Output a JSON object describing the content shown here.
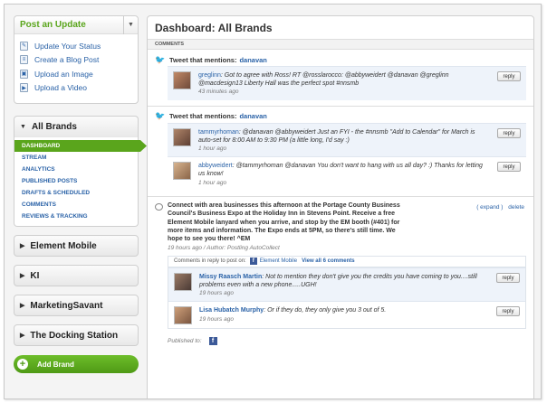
{
  "sidebar": {
    "post_update": {
      "title": "Post an Update",
      "items": [
        {
          "label": "Update Your Status",
          "icon": "status-icon"
        },
        {
          "label": "Create a Blog Post",
          "icon": "blog-icon"
        },
        {
          "label": "Upload an Image",
          "icon": "image-icon"
        },
        {
          "label": "Upload a Video",
          "icon": "video-icon"
        }
      ]
    },
    "all_brands": {
      "label": "All Brands",
      "submenu": [
        "DASHBOARD",
        "STREAM",
        "ANALYTICS",
        "PUBLISHED POSTS",
        "DRAFTS & SCHEDULED",
        "COMMENTS",
        "REVIEWS & TRACKING"
      ],
      "active": "DASHBOARD"
    },
    "brands": [
      "Element Mobile",
      "KI",
      "MarketingSavant",
      "The Docking Station"
    ],
    "add_brand": "Add Brand"
  },
  "main": {
    "title": "Dashboard: All Brands",
    "section_label": "COMMENTS",
    "tweet1": {
      "head": "Tweet that mentions:",
      "mention": "danavan",
      "items": [
        {
          "user": "greglinn",
          "text": ": Got to agree with Ross! RT @rosslarocco: @abbyweidert @danavan @greglinn @macdesign13 Liberty Hall was the perfect spot #nnsmb",
          "time": "43 minutes ago"
        }
      ]
    },
    "tweet2": {
      "head": "Tweet that mentions:",
      "mention": "danavan",
      "items": [
        {
          "user": "tammyrhoman",
          "text": ": @danavan @abbyweidert Just an FYI - the #nnsmb \"Add to Calendar\" for March is auto-set for 8:00 AM to 9:30 PM (a little long, I'd say :)",
          "time": "1 hour ago"
        },
        {
          "user": "abbyweidert",
          "text": ": @tammyrhoman @danavan You don't want to hang with us all day? :) Thanks for letting us know!",
          "time": "1 hour ago"
        }
      ]
    },
    "reply_label": "reply",
    "fb_post": {
      "text": "Connect with area businesses this afternoon at the Portage County Business Council's Business Expo at the Holiday Inn in Stevens Point. Receive a free Element Mobile lanyard when you arrive, and stop by the EM booth (#401) for more items and information. The Expo ends at 5PM, so there's still time. We hope to see you there! ^EM",
      "meta": "19 hours ago / Author: Postling AutoCollect",
      "expand": "( expand )",
      "delete": "delete",
      "comments_head": "Comments in reply to post on:",
      "comments_page": "Element Mobile",
      "view_all": "View all 6 comments",
      "comments": [
        {
          "user": "Missy Raasch Martin",
          "text": ": Not to mention they don't give you the credits you have coming to you....still problems even with a new phone.....UGH!",
          "time": "19 hours ago"
        },
        {
          "user": "Lisa Hubatch Murphy",
          "text": ": Or if they do, they only give you 3 out of 5.",
          "time": "19 hours ago"
        }
      ],
      "published_to": "Published to:"
    }
  }
}
